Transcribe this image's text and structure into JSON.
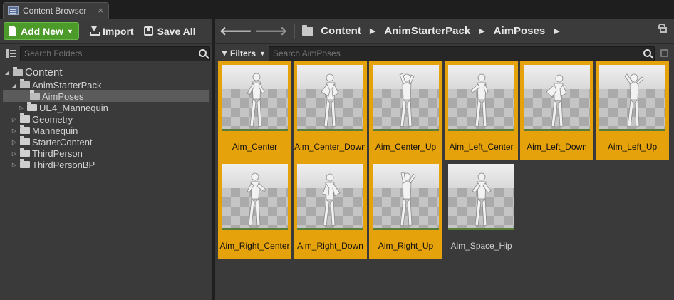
{
  "tab": {
    "title": "Content Browser",
    "close": "×"
  },
  "toolbar": {
    "add_new": "Add New",
    "import": "Import",
    "save_all": "Save All"
  },
  "breadcrumb": [
    "Content",
    "AnimStarterPack",
    "AimPoses"
  ],
  "folder_search": {
    "placeholder": "Search Folders"
  },
  "asset_search": {
    "placeholder": "Search AimPoses"
  },
  "filters_label": "Filters",
  "tree": {
    "root": "Content",
    "items": [
      {
        "label": "AnimStarterPack"
      },
      {
        "label": "AimPoses"
      },
      {
        "label": "UE4_Mannequin"
      },
      {
        "label": "Geometry"
      },
      {
        "label": "Mannequin"
      },
      {
        "label": "StarterContent"
      },
      {
        "label": "ThirdPerson"
      },
      {
        "label": "ThirdPersonBP"
      }
    ]
  },
  "assets": [
    {
      "name": "Aim_Center"
    },
    {
      "name": "Aim_Center_Down"
    },
    {
      "name": "Aim_Center_Up"
    },
    {
      "name": "Aim_Left_Center"
    },
    {
      "name": "Aim_Left_Down"
    },
    {
      "name": "Aim_Left_Up"
    },
    {
      "name": "Aim_Right_Center"
    },
    {
      "name": "Aim_Right_Down"
    },
    {
      "name": "Aim_Right_Up"
    },
    {
      "name": "Aim_Space_Hip"
    }
  ],
  "colors": {
    "add_new": "#4c9a2a",
    "selection": "#e5a20a",
    "panel": "#3a3a3a"
  }
}
